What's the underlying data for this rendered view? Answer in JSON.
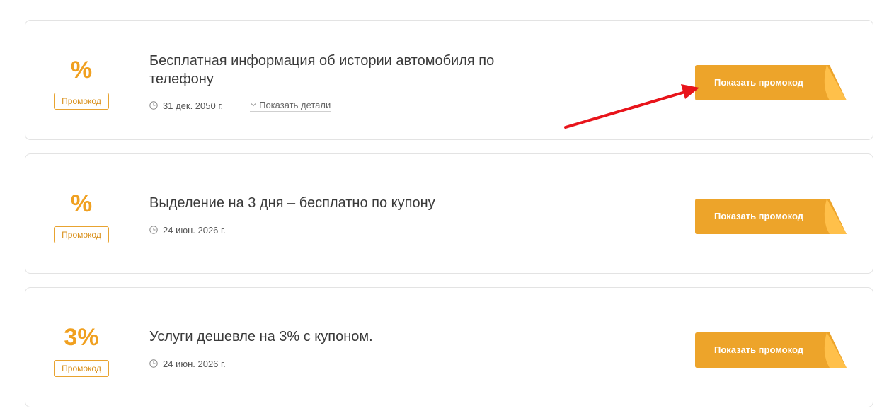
{
  "coupons": [
    {
      "discount": "%",
      "badge": "Промокод",
      "title": "Бесплатная информация об истории автомобиля по телефону",
      "date": "31 дек. 2050 г.",
      "details_label": "Показать детали",
      "button_label": "Показать промокод"
    },
    {
      "discount": "%",
      "badge": "Промокод",
      "title": "Выделение на 3 дня – бесплатно по купону",
      "date": "24 июн. 2026 г.",
      "button_label": "Показать промокод"
    },
    {
      "discount": "3%",
      "badge": "Промокод",
      "title": "Услуги дешевле на 3% с купоном.",
      "date": "24 июн. 2026 г.",
      "button_label": "Показать промокод"
    }
  ],
  "colors": {
    "accent": "#F0A020",
    "button": "#EDA42A",
    "button_fold": "#FFC04A",
    "annotation_arrow": "#E8141B"
  },
  "icons": {
    "clock": "clock-icon",
    "chevron": "chevron-down-icon"
  }
}
